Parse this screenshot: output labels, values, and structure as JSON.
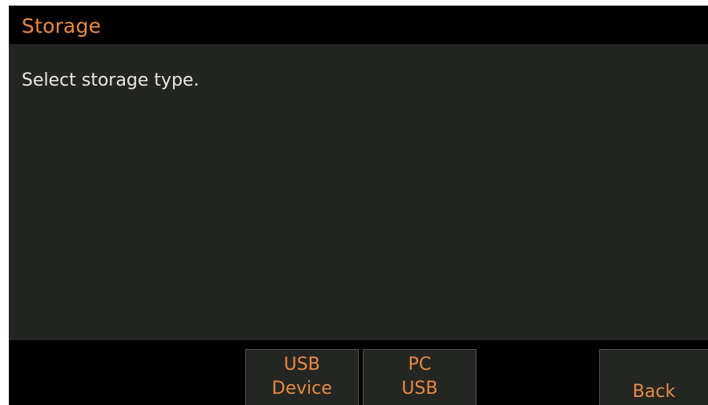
{
  "screen": {
    "title": "Storage",
    "message": "Select storage type."
  },
  "softkeys": {
    "usb_device": {
      "line1": "USB",
      "line2": "Device"
    },
    "pc_usb": {
      "line1": "PC",
      "line2": "USB"
    },
    "back": {
      "label": "Back"
    }
  },
  "colors": {
    "accent": "#ea8a42",
    "background": "#232522",
    "bar": "#000000",
    "text": "#e9e9e4",
    "button": "#242623"
  }
}
